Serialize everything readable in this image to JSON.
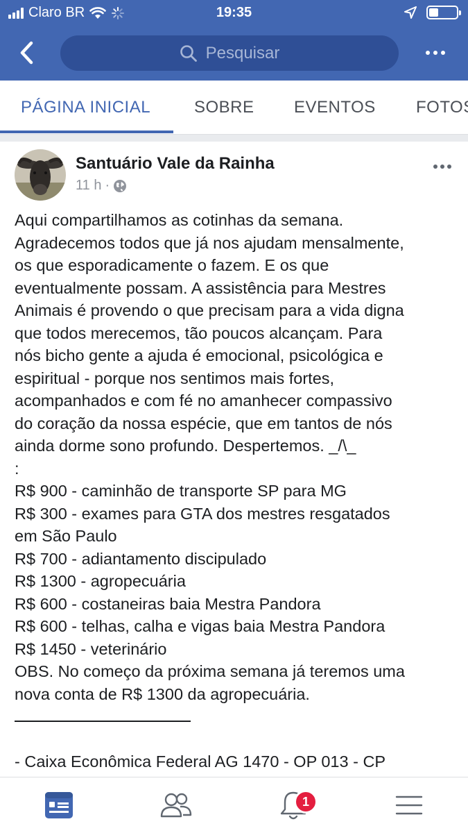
{
  "status_bar": {
    "carrier": "Claro BR",
    "time": "19:35"
  },
  "header": {
    "search_placeholder": "Pesquisar",
    "icons": [
      "back-chevron-icon",
      "search-icon",
      "more-dots-icon"
    ]
  },
  "tabs": [
    {
      "label": "PÁGINA INICIAL",
      "active": true
    },
    {
      "label": "SOBRE",
      "active": false
    },
    {
      "label": "EVENTOS",
      "active": false
    },
    {
      "label": "FOTOS",
      "active": false
    }
  ],
  "post": {
    "page_name": "Santuário Vale da Rainha",
    "time": "11 h",
    "separator": "·",
    "privacy_icon": "globe-icon",
    "lines": [
      "Aqui compartilhamos as cotinhas da semana.",
      "Agradecemos todos que já nos ajudam mensalmente,",
      "os que esporadicamente o fazem. E os que",
      "eventualmente possam. A assistência para Mestres",
      "Animais é provendo o que precisam para a vida digna",
      "que todos merecemos, tão poucos alcançam. Para",
      "nós bicho gente a ajuda é emocional, psicológica e",
      "espiritual - porque nos sentimos mais fortes,",
      "acompanhados e com fé no amanhecer compassivo",
      "do coração da nossa espécie, que em tantos de nós",
      "ainda dorme sono profundo. Despertemos. _/\\_",
      ":",
      "R$ 900 - caminhão de transporte SP para MG",
      "R$ 300 - exames para GTA dos mestres resgatados",
      "em São Paulo",
      "R$ 700 - adiantamento discipulado",
      "R$ 1300 - agropecuária",
      "R$ 600 - costaneiras baia Mestra Pandora",
      "R$ 600 - telhas, calha e vigas baia Mestra Pandora",
      "R$ 1450 - veterinário",
      "OBS. No começo da próxima semana já teremos uma",
      "nova conta de R$ 1300 da agropecuária."
    ],
    "bank_line": "- Caixa Econômica Federal AG 1470 - OP 013 - CP"
  },
  "bottom_nav": {
    "items": [
      "news-feed-icon",
      "friends-icon",
      "notifications-bell-icon",
      "menu-hamburger-icon"
    ],
    "notification_count": "1"
  },
  "colors": {
    "brand_blue": "#4267b2",
    "badge_red": "#e41e3f"
  }
}
